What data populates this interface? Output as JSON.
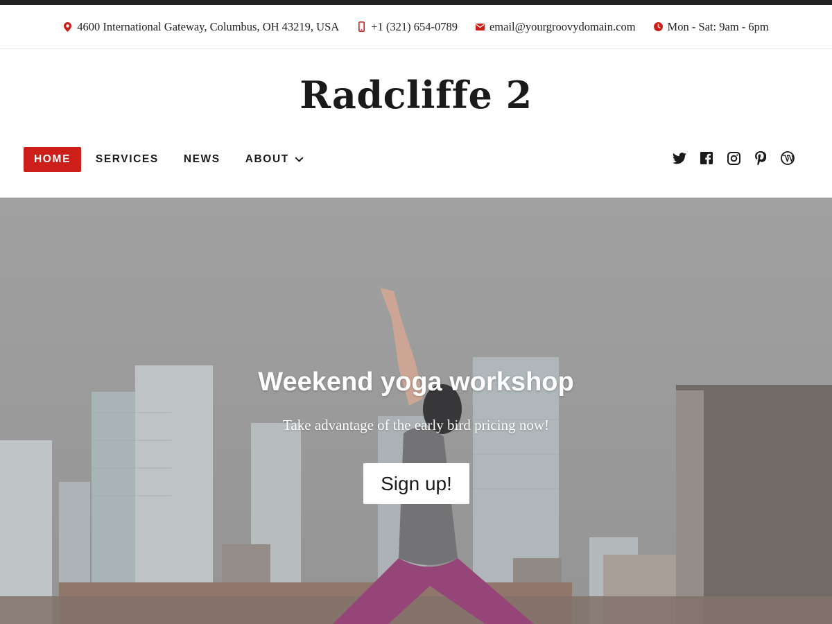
{
  "info_bar": {
    "address": "4600 International Gateway, Columbus, OH 43219, USA",
    "phone": "+1 (321) 654-0789",
    "email": "email@yourgroovydomain.com",
    "hours": "Mon - Sat: 9am - 6pm",
    "icon_color": "#cc1f1a"
  },
  "site": {
    "title": "Radcliffe 2"
  },
  "nav": {
    "items": [
      {
        "label": "HOME",
        "active": true
      },
      {
        "label": "SERVICES"
      },
      {
        "label": "NEWS"
      },
      {
        "label": "ABOUT",
        "has_dropdown": true
      }
    ],
    "active_color": "#cc1f1a"
  },
  "social": {
    "icons": [
      "twitter-icon",
      "facebook-icon",
      "instagram-icon",
      "pinterest-icon",
      "wordpress-icon"
    ]
  },
  "hero": {
    "title": "Weekend yoga workshop",
    "subtitle": "Take advantage of the early bird pricing now!",
    "button_label": "Sign up!"
  }
}
